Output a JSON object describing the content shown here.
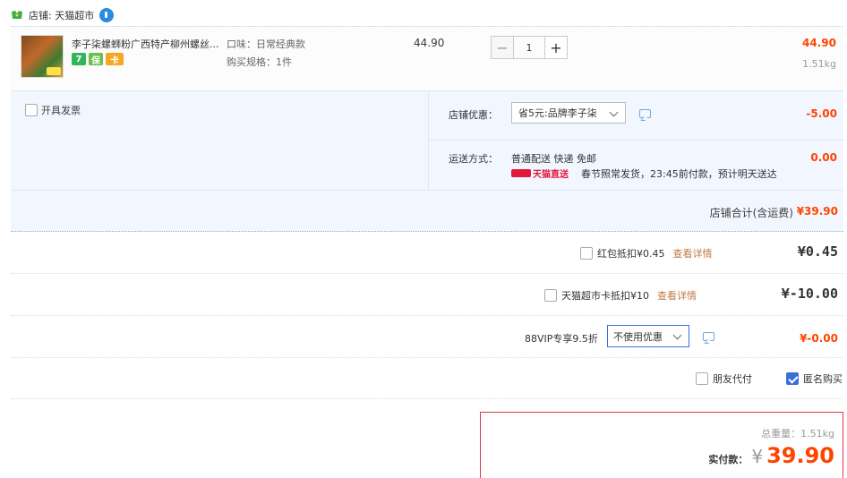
{
  "shop": {
    "label": "店铺: 天猫超市",
    "icon": "shop-icon",
    "chat_icon": "wangwang-icon"
  },
  "item": {
    "title": "李子柒螺蛳粉广西特产柳州螺丝...",
    "flavor": "口味：日常经典款",
    "spec": "购买规格：1件",
    "unit_price": "44.90",
    "quantity": "1",
    "minus": "−",
    "plus": "+",
    "total": "44.90",
    "weight": "1.51kg",
    "badges": [
      "7",
      "保",
      "卡"
    ]
  },
  "promotion": {
    "invoice_label": "开具发票",
    "coupon_label": "店铺优惠：",
    "coupon_value": "省5元:品牌李子柒",
    "coupon_discount": "-5.00",
    "shipping_label": "运送方式：",
    "shipping_method": "普通配送 快递 免邮",
    "tmall_tag": "天猫直送",
    "shipping_note": "春节照常发货，23:45前付款，预计明天送达",
    "shipping_fee": "0.00"
  },
  "shop_total": {
    "label": "店铺合计(含运费)",
    "value": "¥39.90"
  },
  "redpack": {
    "label": "红包抵扣¥0.45",
    "link": "查看详情",
    "amount": "¥0.45"
  },
  "card": {
    "label": "天猫超市卡抵扣¥10",
    "link": "查看详情",
    "amount": "¥-10.00"
  },
  "vip": {
    "label": "88VIP专享9.5折",
    "select_value": "不使用优惠",
    "amount": "¥-0.00"
  },
  "options": {
    "friend_pay": "朋友代付",
    "anonymous": "匿名购买",
    "anonymous_checked": true
  },
  "payment": {
    "weight": "总重量：1.51kg",
    "label": "实付款：",
    "currency": "¥",
    "amount": "39.90"
  },
  "colors": {
    "accent_red": "#ff4400",
    "link_brown": "#c27a44",
    "panel_blue": "#f2f7ff",
    "check_blue": "#3b6fd8"
  }
}
